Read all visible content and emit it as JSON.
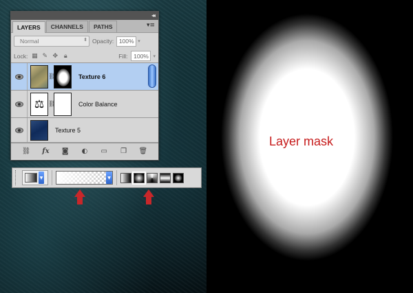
{
  "layers_panel": {
    "tabs": [
      "LAYERS",
      "CHANNELS",
      "PATHS"
    ],
    "blend_mode": "Normal",
    "opacity_label": "Opacity:",
    "opacity_value": "100%",
    "lock_label": "Lock:",
    "fill_label": "Fill:",
    "fill_value": "100%",
    "layers": [
      {
        "name": "Texture 6",
        "selected": true,
        "visible": true,
        "has_mask": true
      },
      {
        "name": "Color Balance",
        "selected": false,
        "visible": true,
        "adjustment": true
      },
      {
        "name": "Texture 5",
        "selected": false,
        "visible": true
      }
    ],
    "footer_icons": [
      "link-icon",
      "fx-icon",
      "add-mask-icon",
      "adjustment-icon",
      "folder-icon",
      "new-layer-icon",
      "trash-icon"
    ]
  },
  "gradient_bar": {
    "gradient_types": [
      "linear",
      "radial",
      "angle",
      "reflected",
      "diamond"
    ],
    "selected_type": "radial",
    "gradient_preset": "white-to-transparent"
  },
  "annotation": {
    "mask_label": "Layer mask",
    "label_color": "#c61b1b",
    "arrow_color": "#c8272a"
  }
}
